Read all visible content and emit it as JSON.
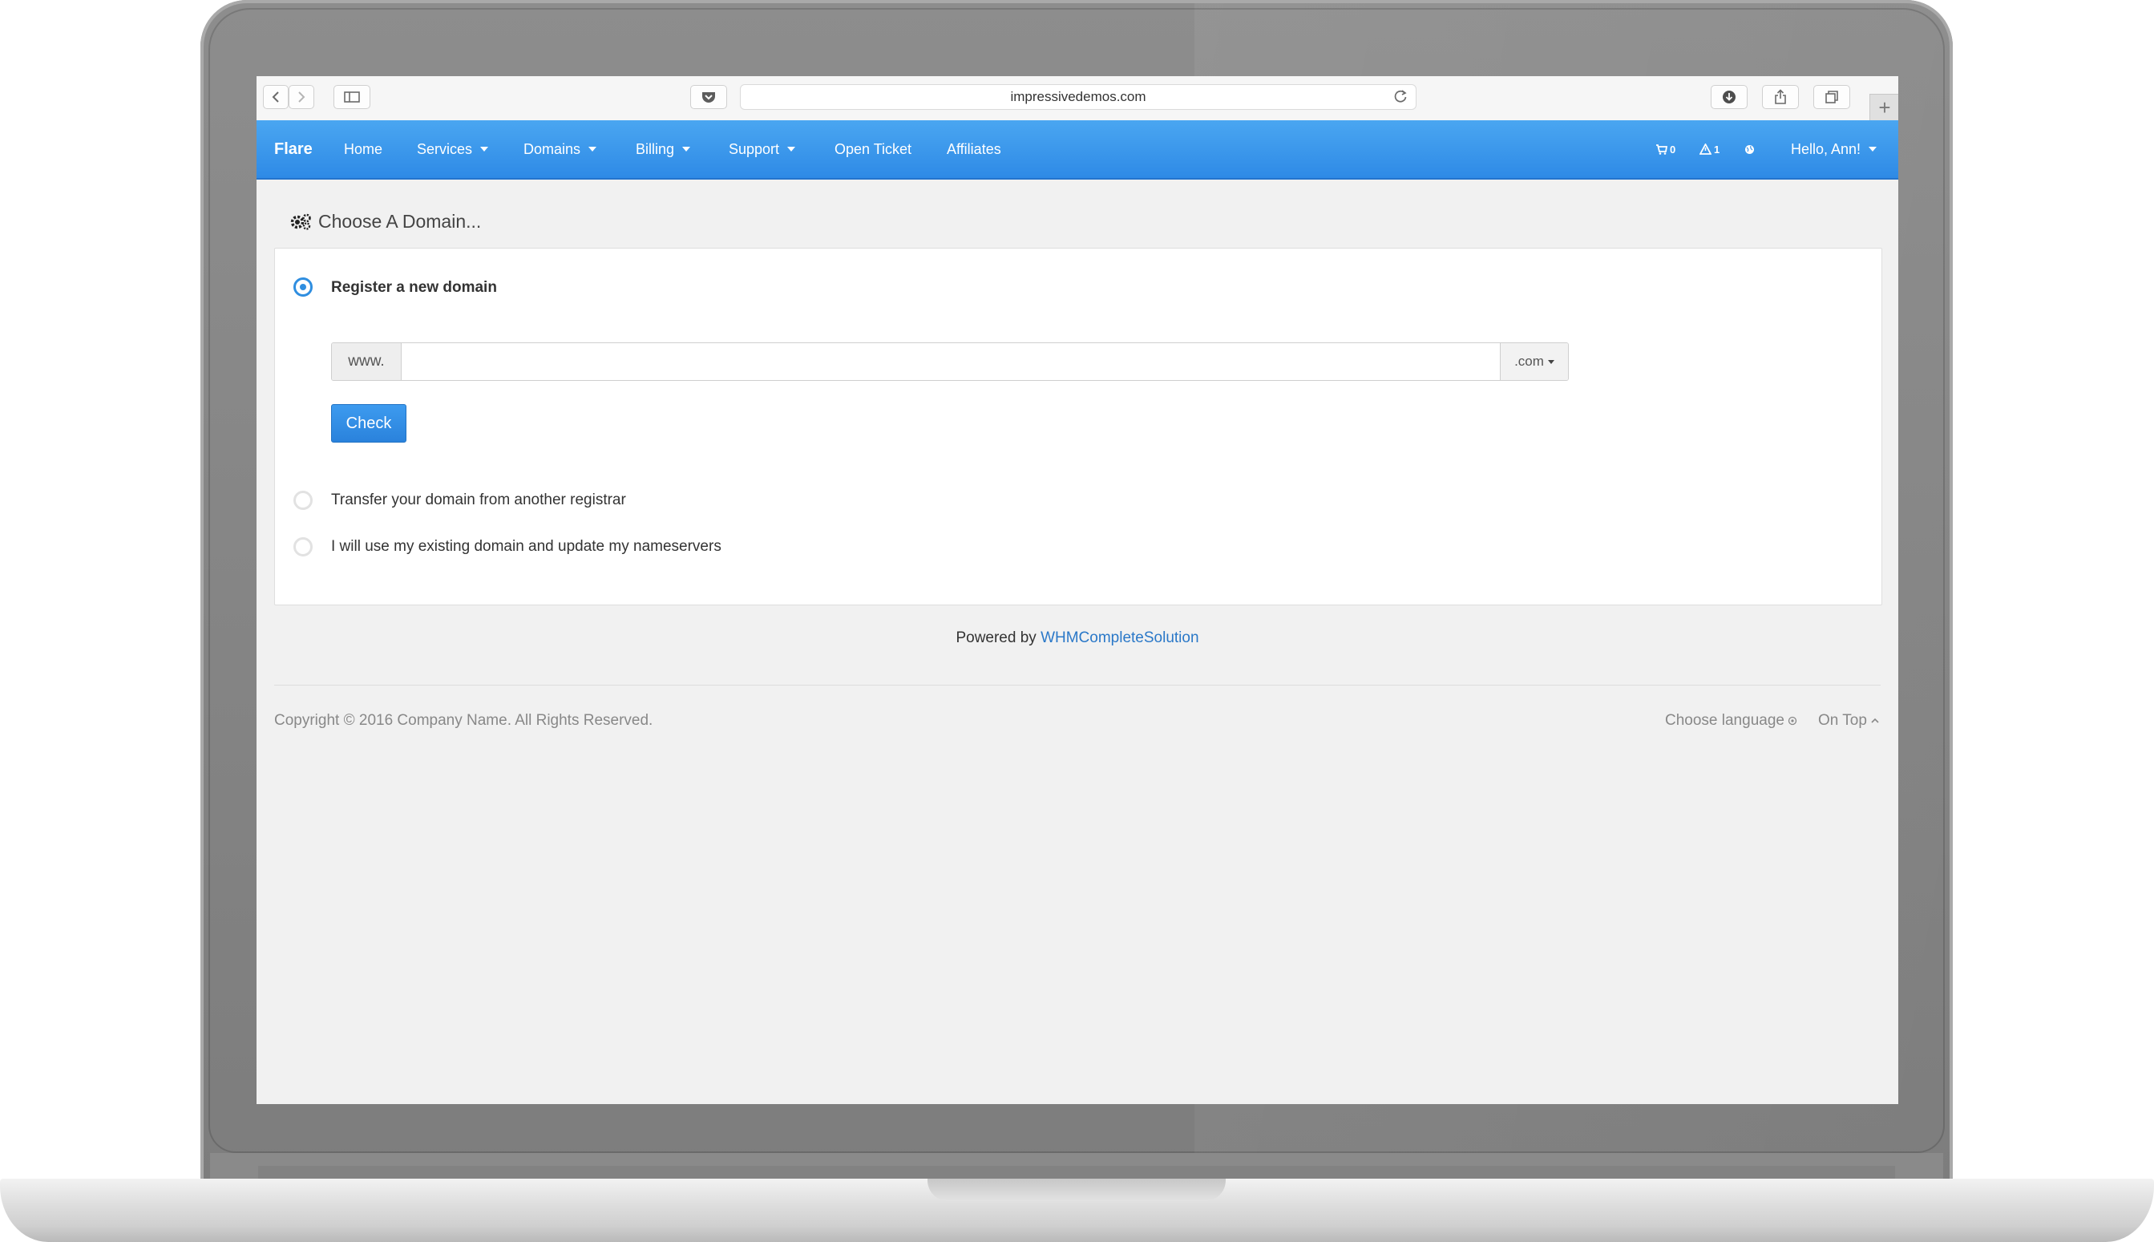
{
  "browser": {
    "url": "impressivedemos.com"
  },
  "nav": {
    "brand": "Flare",
    "items": [
      {
        "label": "Home"
      },
      {
        "label": "Services"
      },
      {
        "label": "Domains"
      },
      {
        "label": "Billing"
      },
      {
        "label": "Support"
      },
      {
        "label": "Open Ticket"
      },
      {
        "label": "Affiliates"
      }
    ],
    "cart_count": "0",
    "alert_count": "1",
    "user_label": "Hello, Ann!"
  },
  "page": {
    "title": "Choose A Domain..."
  },
  "domain_options": {
    "register_label": "Register a new domain",
    "www_prefix": "www.",
    "domain_value": "",
    "tld_selected": ".com",
    "check_label": "Check",
    "transfer_label": "Transfer your domain from another registrar",
    "existing_label": "I will use my existing domain and update my nameservers",
    "selected": "register"
  },
  "footer": {
    "powered_prefix": "Powered by",
    "powered_link": "WHMCompleteSolution",
    "copyright": "Copyright © 2016 Company Name. All Rights Reserved.",
    "choose_language": "Choose language",
    "on_top": "On Top"
  },
  "colors": {
    "nav_top": "#4aa6f1",
    "nav_bottom": "#2e8ae6",
    "accent": "#2f8ee0",
    "link": "#2a78c8"
  }
}
